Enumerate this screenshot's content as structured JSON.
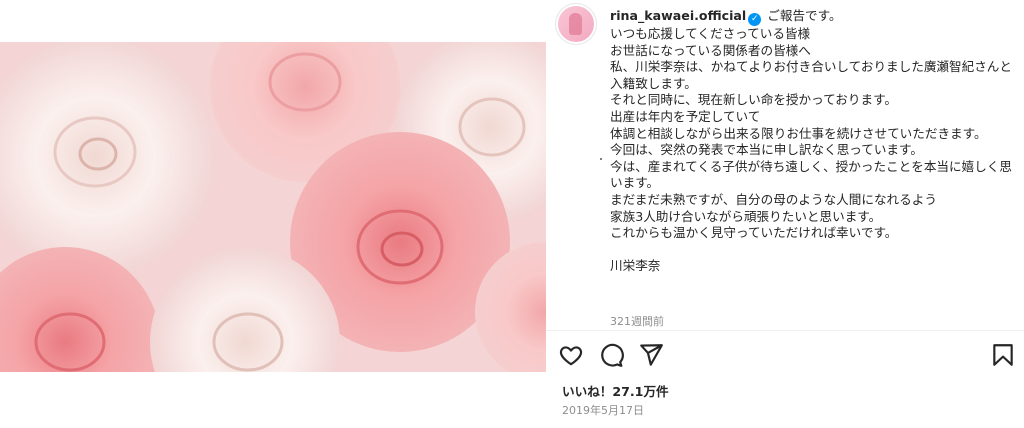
{
  "post": {
    "username": "rina_kawaei.official",
    "caption_lines": [
      "ご報告です。",
      "いつも応援してくださっている皆様",
      "お世話になっている関係者の皆様へ",
      "私、川栄李奈は、かねてよりお付き合いしておりました廣瀬智紀さんと入籍致します。",
      "それと同時に、現在新しい命を授かっております。",
      "出産は年内を予定していて",
      "体調と相談しながら出来る限りお仕事を続けさせていただきます。",
      "今回は、突然の発表で本当に申し訳なく思っています。",
      "今は、産まれてくる子供が待ち遠しく、授かったことを本当に嬉しく思います。",
      "まだまだ未熟ですが、自分の母のような人間になれるよう",
      "家族3人助け合いながら頑張りたいと思います。",
      "これからも温かく見守っていただければ幸いです。",
      "",
      "川栄李奈"
    ],
    "time_ago": "321週間前",
    "likes": "いいね！27.1万件",
    "date": "2019年5月17日"
  },
  "icons": {
    "like": "heart-icon",
    "comment": "comment-icon",
    "share": "share-icon",
    "save": "bookmark-icon",
    "verified": "verified-badge-icon"
  },
  "colors": {
    "verified": "#0095f6",
    "muted_text": "#8e8e8e",
    "text": "#262626"
  }
}
